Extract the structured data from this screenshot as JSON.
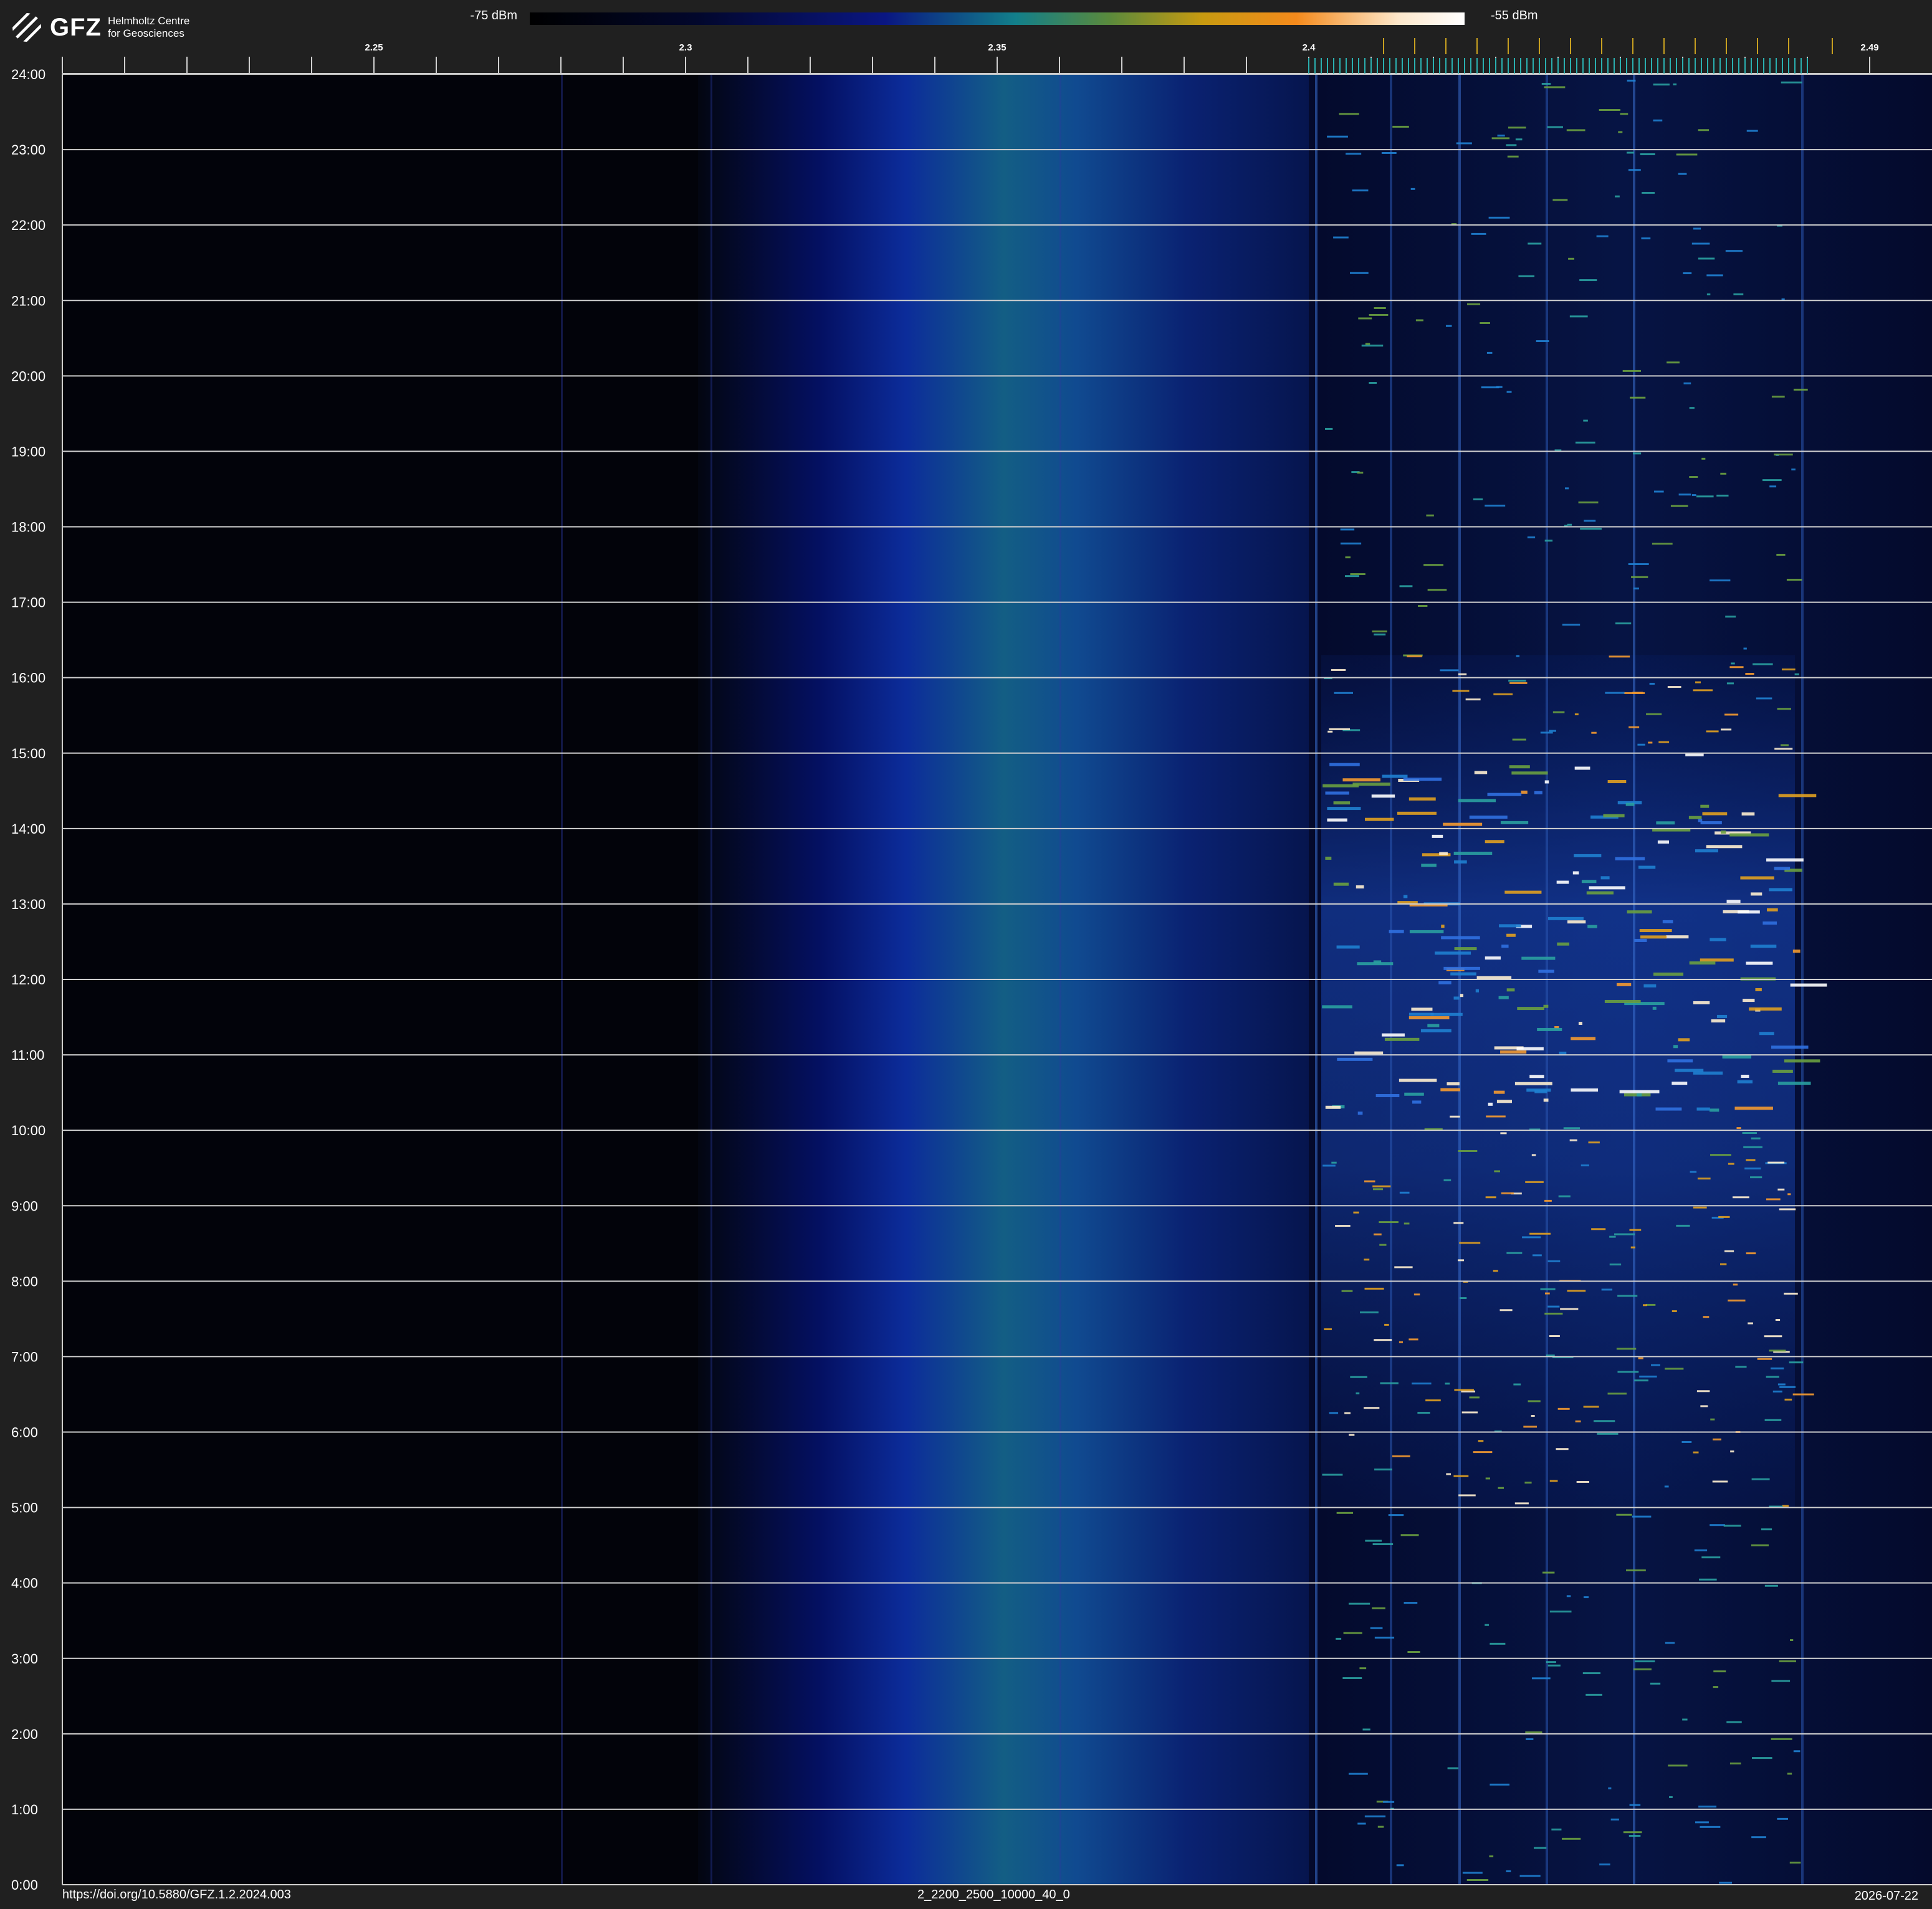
{
  "header": {
    "logo": {
      "word": "GFZ",
      "subtitle_line1": "Helmholtz Centre",
      "subtitle_line2": "for Geosciences"
    },
    "colorbar": {
      "min_label": "-75 dBm",
      "max_label": "-55 dBm"
    }
  },
  "footer": {
    "doi": "https://doi.org/10.5880/GFZ.1.2.2024.003",
    "dataset_id": "2_2200_2500_10000_40_0",
    "date": "2026-07-22"
  },
  "chart_data": {
    "type": "heatmap",
    "x_unit": "GHz",
    "xlim": [
      2.2,
      2.49
    ],
    "x_ticks": [
      2.25,
      2.3,
      2.35,
      2.4,
      2.49
    ],
    "x_tick_labels": [
      "2.25",
      "2.3",
      "2.35",
      "2.4",
      "2.49"
    ],
    "y_ticks": [
      0,
      1,
      2,
      3,
      4,
      5,
      6,
      7,
      8,
      9,
      10,
      11,
      12,
      13,
      14,
      15,
      16,
      17,
      18,
      19,
      20,
      21,
      22,
      23,
      24
    ],
    "y_tick_labels": [
      "0:00",
      "1:00",
      "2:00",
      "3:00",
      "4:00",
      "5:00",
      "6:00",
      "7:00",
      "8:00",
      "9:00",
      "10:00",
      "11:00",
      "12:00",
      "13:00",
      "14:00",
      "15:00",
      "16:00",
      "17:00",
      "18:00",
      "19:00",
      "20:00",
      "21:00",
      "22:00",
      "23:00",
      "24:00"
    ],
    "ylim": [
      0,
      24
    ],
    "colorscale": {
      "min_dbm": -75,
      "max_dbm": -55
    },
    "features": {
      "broadband_noise_band": {
        "x_start": 2.31,
        "x_peak": 2.336,
        "x_end": 2.4
      },
      "wifi_band": {
        "x_start": 2.4,
        "x_end": 2.48
      },
      "active_hours": [
        5.0,
        16.3
      ],
      "peak_hours": [
        10.2,
        15.0
      ]
    },
    "grid": true,
    "colors": {
      "background": "#202020",
      "gridline": "#d0d0d0",
      "lowest": "#000000",
      "highest": "#ffffff"
    }
  }
}
